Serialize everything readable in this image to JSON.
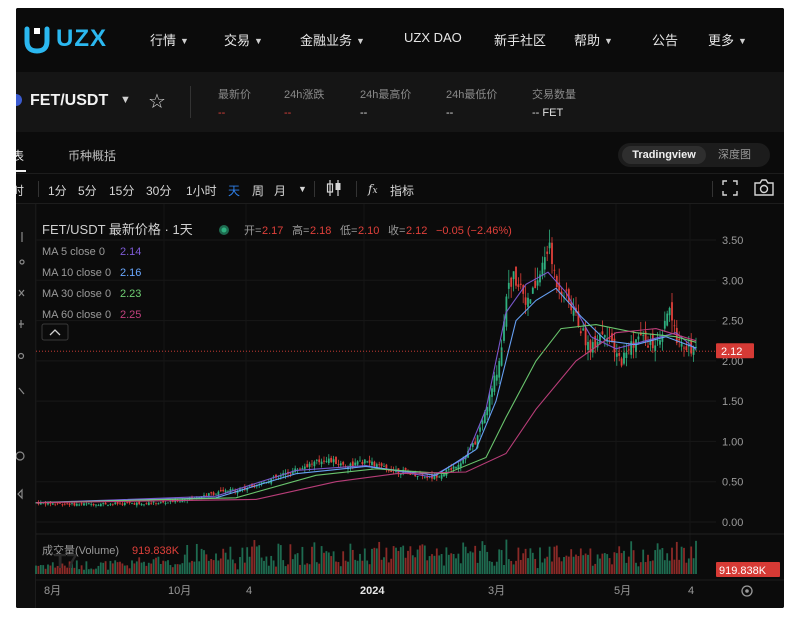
{
  "nav": {
    "logo_text": "UZX",
    "items": [
      {
        "label": "行情",
        "dropdown": true
      },
      {
        "label": "交易",
        "dropdown": true
      },
      {
        "label": "金融业务",
        "dropdown": true
      },
      {
        "label": "UZX DAO",
        "dropdown": false
      },
      {
        "label": "新手社区",
        "dropdown": false
      },
      {
        "label": "帮助",
        "dropdown": true
      },
      {
        "label": "公告",
        "dropdown": false
      },
      {
        "label": "更多",
        "dropdown": true
      }
    ]
  },
  "symbol_header": {
    "symbol": "FET/USDT",
    "stats": [
      {
        "label": "最新价",
        "value": "--",
        "color": "#e0403a"
      },
      {
        "label": "24h涨跌",
        "value": "--",
        "color": "#e0403a"
      },
      {
        "label": "24h最高价",
        "value": "--",
        "color": "#e0e0e0"
      },
      {
        "label": "24h最低价",
        "value": "--",
        "color": "#e0e0e0"
      },
      {
        "label": "交易数量",
        "value": "-- FET",
        "color": "#e0e0e0"
      }
    ]
  },
  "tabs": {
    "chart_partial": "表",
    "overview": "币种概括",
    "view_toggle": [
      "Tradingview",
      "深度图"
    ]
  },
  "toolbar": {
    "partial_left": "时",
    "intervals": [
      "1分",
      "5分",
      "15分",
      "30分",
      "1小时",
      "天",
      "周",
      "月"
    ],
    "active_interval": "天",
    "indicators_label": "指标",
    "icons": [
      "chevron-down-icon",
      "candles-icon",
      "fx-icon",
      "fullscreen-icon",
      "camera-icon"
    ]
  },
  "chart_data": {
    "type": "candlestick",
    "legend_title": "FET/USDT 最新价格 · 1天",
    "ohlc": {
      "open_label": "开=",
      "open": "2.17",
      "high_label": "高=",
      "high": "2.18",
      "low_label": "低=",
      "low": "2.10",
      "close_label": "收=",
      "close": "2.12",
      "change": "−0.05 (−2.46%)"
    },
    "ma": [
      {
        "label": "MA 5 close 0",
        "value": "2.14",
        "color": "#7e5bd6"
      },
      {
        "label": "MA 10 close 0",
        "value": "2.16",
        "color": "#6aa8ff"
      },
      {
        "label": "MA 30 close 0",
        "value": "2.23",
        "color": "#6fcf73"
      },
      {
        "label": "MA 60 close 0",
        "value": "2.25",
        "color": "#c2407e"
      }
    ],
    "y_ticks": [
      "3.50",
      "3.00",
      "2.50",
      "2.00",
      "1.50",
      "1.00",
      "0.50",
      "0.00"
    ],
    "y_range": [
      0,
      3.5
    ],
    "last_price_label": "2.12",
    "x_ticks": [
      "8月",
      "10月",
      "4",
      "2024",
      "3月",
      "5月",
      "4"
    ],
    "volume": {
      "label": "成交量(Volume)",
      "value": "919.838K",
      "badge": "919.838K"
    },
    "price_path": [
      [
        0,
        0.24
      ],
      [
        40,
        0.22
      ],
      [
        90,
        0.23
      ],
      [
        130,
        0.24
      ],
      [
        180,
        0.36
      ],
      [
        210,
        0.42
      ],
      [
        240,
        0.55
      ],
      [
        270,
        0.7
      ],
      [
        290,
        0.78
      ],
      [
        310,
        0.7
      ],
      [
        330,
        0.75
      ],
      [
        350,
        0.66
      ],
      [
        370,
        0.62
      ],
      [
        395,
        0.55
      ],
      [
        410,
        0.62
      ],
      [
        425,
        0.75
      ],
      [
        440,
        1.0
      ],
      [
        455,
        1.6
      ],
      [
        465,
        2.1
      ],
      [
        470,
        2.85
      ],
      [
        478,
        3.05
      ],
      [
        485,
        2.95
      ],
      [
        492,
        2.7
      ],
      [
        500,
        2.95
      ],
      [
        505,
        3.1
      ],
      [
        512,
        3.45
      ],
      [
        520,
        3.0
      ],
      [
        530,
        2.8
      ],
      [
        540,
        2.55
      ],
      [
        548,
        2.3
      ],
      [
        555,
        2.15
      ],
      [
        562,
        2.3
      ],
      [
        570,
        2.4
      ],
      [
        578,
        2.1
      ],
      [
        585,
        2.0
      ],
      [
        595,
        2.2
      ],
      [
        605,
        2.3
      ],
      [
        615,
        2.2
      ],
      [
        625,
        2.2
      ],
      [
        632,
        2.65
      ],
      [
        640,
        2.3
      ],
      [
        650,
        2.2
      ],
      [
        660,
        2.12
      ]
    ],
    "ma_paths": [
      [
        [
          0,
          0.24
        ],
        [
          180,
          0.32
        ],
        [
          260,
          0.64
        ],
        [
          330,
          0.7
        ],
        [
          395,
          0.56
        ],
        [
          430,
          0.8
        ],
        [
          450,
          1.4
        ],
        [
          470,
          2.6
        ],
        [
          490,
          2.95
        ],
        [
          512,
          3.1
        ],
        [
          530,
          2.85
        ],
        [
          555,
          2.3
        ],
        [
          580,
          2.15
        ],
        [
          610,
          2.25
        ],
        [
          640,
          2.35
        ],
        [
          660,
          2.14
        ]
      ],
      [
        [
          0,
          0.24
        ],
        [
          180,
          0.3
        ],
        [
          260,
          0.6
        ],
        [
          330,
          0.69
        ],
        [
          400,
          0.58
        ],
        [
          440,
          0.9
        ],
        [
          460,
          1.5
        ],
        [
          480,
          2.5
        ],
        [
          500,
          2.75
        ],
        [
          520,
          2.9
        ],
        [
          545,
          2.55
        ],
        [
          570,
          2.25
        ],
        [
          600,
          2.2
        ],
        [
          630,
          2.3
        ],
        [
          660,
          2.16
        ]
      ],
      [
        [
          0,
          0.24
        ],
        [
          200,
          0.3
        ],
        [
          280,
          0.58
        ],
        [
          340,
          0.66
        ],
        [
          410,
          0.6
        ],
        [
          450,
          0.8
        ],
        [
          470,
          1.3
        ],
        [
          500,
          2.0
        ],
        [
          525,
          2.4
        ],
        [
          560,
          2.45
        ],
        [
          600,
          2.35
        ],
        [
          640,
          2.3
        ],
        [
          660,
          2.23
        ]
      ],
      [
        [
          0,
          0.24
        ],
        [
          220,
          0.28
        ],
        [
          300,
          0.5
        ],
        [
          360,
          0.6
        ],
        [
          430,
          0.62
        ],
        [
          470,
          0.85
        ],
        [
          500,
          1.4
        ],
        [
          540,
          2.0
        ],
        [
          580,
          2.35
        ],
        [
          620,
          2.4
        ],
        [
          660,
          2.25
        ]
      ]
    ]
  }
}
